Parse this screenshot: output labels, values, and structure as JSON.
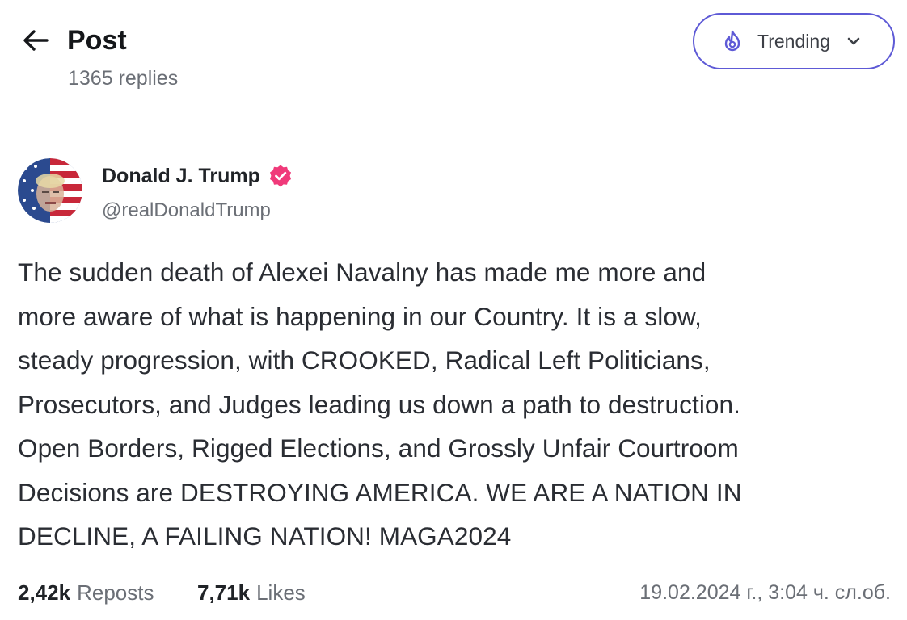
{
  "header": {
    "title": "Post",
    "reply_count": "1365 replies",
    "back_icon": "arrow-left-icon",
    "sort": {
      "label": "Trending",
      "icon": "flame-icon",
      "dropdown_icon": "chevron-down-icon"
    }
  },
  "author": {
    "name": "Donald J. Trump",
    "handle": "@realDonaldTrump",
    "verified_icon": "verified-badge-icon"
  },
  "post": {
    "lines": [
      "The sudden death of Alexei Navalny has made me more and",
      "more aware of what is happening in our Country. It is a slow,",
      "steady progression, with CROOKED, Radical Left Politicians,",
      "Prosecutors, and Judges leading us down a path to destruction.",
      "Open Borders, Rigged Elections, and Grossly Unfair Courtroom",
      "Decisions are DESTROYING AMERICA. WE ARE A NATION IN",
      "DECLINE, A FAILING NATION! MAGA2024"
    ]
  },
  "stats": {
    "reposts_count": "2,42k",
    "reposts_label": "Reposts",
    "likes_count": "7,71k",
    "likes_label": "Likes",
    "timestamp": "19.02.2024 г., 3:04 ч. сл.об."
  },
  "colors": {
    "accent": "#5e5ad6",
    "verified": "#f03a7a",
    "muted_text": "#6b6f76"
  }
}
